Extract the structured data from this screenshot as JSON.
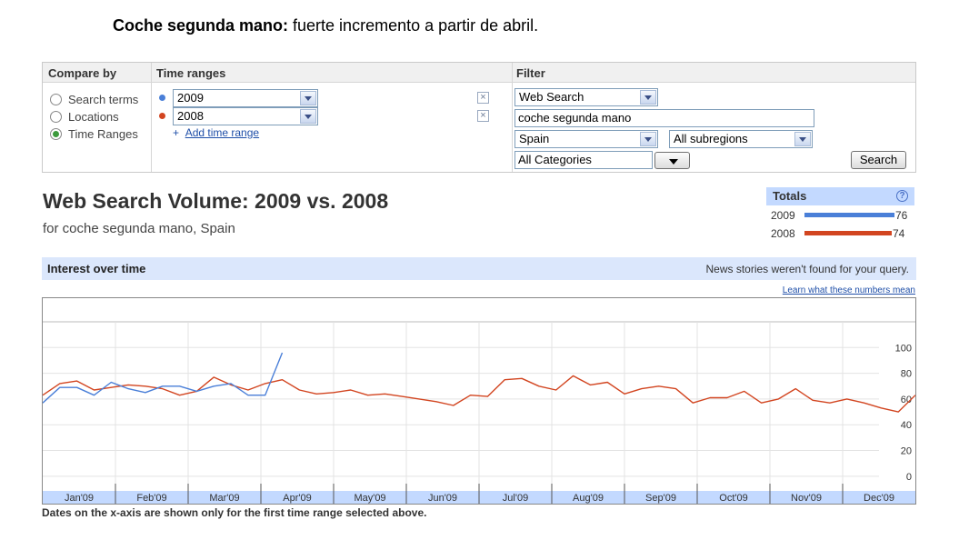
{
  "caption": {
    "bold": "Coche segunda mano:",
    "rest": " fuerte incremento a partir de abril."
  },
  "compare_by": {
    "label": "Compare by",
    "options": [
      {
        "label": "Search terms",
        "selected": false
      },
      {
        "label": "Locations",
        "selected": false
      },
      {
        "label": "Time Ranges",
        "selected": true
      }
    ]
  },
  "time_ranges": {
    "label": "Time ranges",
    "items": [
      {
        "value": "2009",
        "color": "#4a7fd8"
      },
      {
        "value": "2008",
        "color": "#d24520"
      }
    ],
    "add_label": "Add time range",
    "add_prefix": "+"
  },
  "filter": {
    "label": "Filter",
    "property": "Web Search",
    "query": "coche segunda mano",
    "country": "Spain",
    "subregion": "All subregions",
    "category": "All Categories",
    "search_button": "Search"
  },
  "result": {
    "title": "Web Search Volume: 2009 vs. 2008",
    "subtitle": "for coche segunda mano, Spain"
  },
  "totals": {
    "title": "Totals",
    "help": "?",
    "rows": [
      {
        "year": "2009",
        "value": 76,
        "color": "#4a7fd8"
      },
      {
        "year": "2008",
        "value": 74,
        "color": "#d24520"
      }
    ]
  },
  "interest": {
    "title": "Interest over time",
    "news_message": "News stories weren't found for your query.",
    "learn_link": "Learn what these numbers mean"
  },
  "xaxis_note": "Dates on the x-axis are shown only for the first time range selected above.",
  "chart_data": {
    "type": "line",
    "x_unit": "week",
    "x_labels": [
      "Jan'09",
      "Feb'09",
      "Mar'09",
      "Apr'09",
      "May'09",
      "Jun'09",
      "Jul'09",
      "Aug'09",
      "Sep'09",
      "Oct'09",
      "Nov'09",
      "Dec'09"
    ],
    "y_ticks": [
      0,
      20,
      40,
      60,
      80,
      100
    ],
    "ylim": [
      -10,
      120
    ],
    "grid": true,
    "series": [
      {
        "name": "2009",
        "color": "#4a7fd8",
        "values": [
          57,
          69,
          69,
          63,
          73,
          68,
          65,
          70,
          70,
          66,
          70,
          72,
          63,
          63,
          96
        ]
      },
      {
        "name": "2008",
        "color": "#d24520",
        "values": [
          63,
          72,
          74,
          67,
          69,
          71,
          70,
          68,
          63,
          66,
          77,
          71,
          67,
          72,
          75,
          67,
          64,
          65,
          67,
          63,
          64,
          62,
          60,
          58,
          55,
          63,
          62,
          75,
          76,
          70,
          67,
          78,
          71,
          73,
          64,
          68,
          70,
          68,
          57,
          61,
          61,
          66,
          57,
          60,
          68,
          59,
          57,
          60,
          57,
          53,
          50,
          63
        ]
      }
    ]
  }
}
